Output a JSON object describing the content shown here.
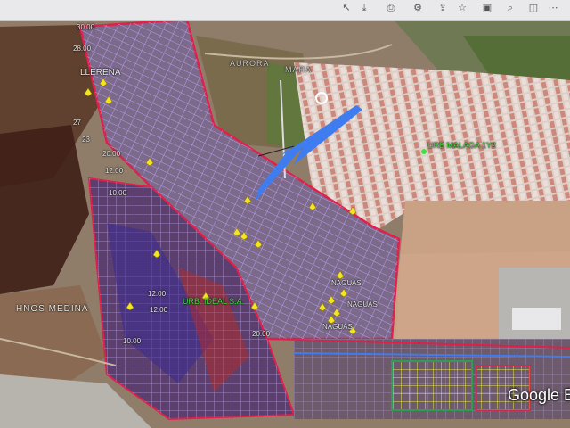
{
  "map": {
    "place_labels": {
      "llerena": "LLERENA",
      "aurora": "AURORA",
      "mark": "MARA",
      "urb_malaga": "URB MALAGA 1Y2",
      "hnos_medina": "HNOS MEDINA",
      "urb_ideal": "URB. IDEAL S.A.",
      "naguas_1": "NAGUAS",
      "naguas_2": "NAGUAS",
      "naguas_3": "NAGUAS"
    },
    "elevation_labels": {
      "e1": "30.00",
      "e2": "28.00",
      "e3": "27",
      "e4": "23",
      "e5": "20.00",
      "e6": "12.00",
      "e7": "10.00",
      "e8": "12.00",
      "e9": "12.00",
      "e10": "10.00",
      "e11": "20.00"
    },
    "attribution": "Google E",
    "accent_colors": {
      "parcel_outline": "#e01f4a",
      "street_grid": "#b7a6ff",
      "arrow": "#3f7cf0",
      "pins": "#f4e522",
      "label_green": "#3fe03f"
    },
    "icons": {
      "pin": "map-pin-icon",
      "location_marker": "location-circle-icon",
      "arrow": "direction-arrow-icon"
    }
  }
}
